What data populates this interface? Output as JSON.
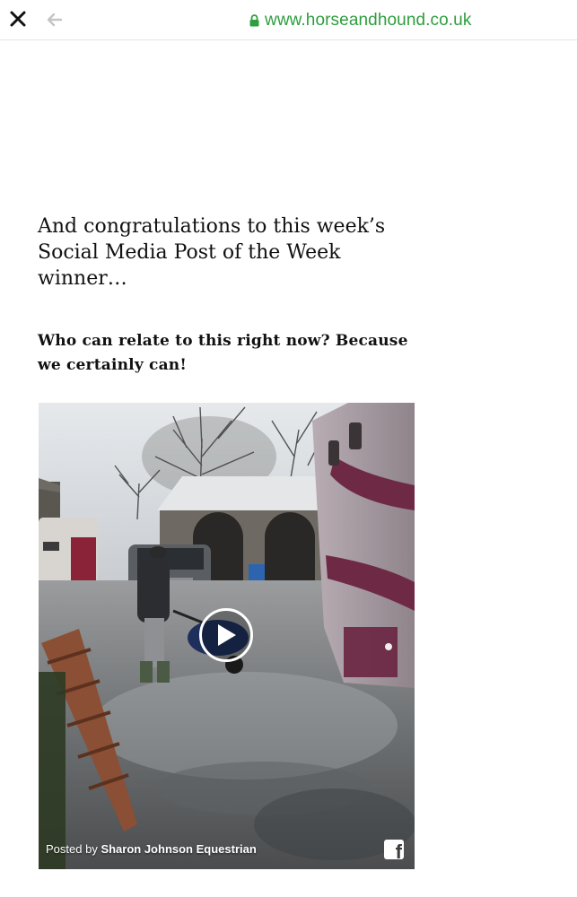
{
  "browser": {
    "url": "www.horseandhound.co.uk",
    "close_icon": "close-icon",
    "back_icon": "arrow-left-icon",
    "lock_icon": "lock-icon",
    "url_color": "#2e9e3e"
  },
  "article": {
    "headline": "And congratulations to this week’s Social Media Post of the Week winner…",
    "subtext": "Who can relate to this right now? Because we certainly can!"
  },
  "video": {
    "posted_by_prefix": "Posted by ",
    "author": "Sharon Johnson Equestrian",
    "play_icon": "play-icon",
    "share_icon": "facebook-icon"
  }
}
